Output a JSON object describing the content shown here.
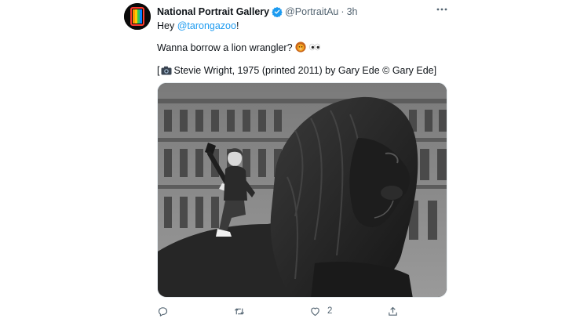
{
  "author": {
    "name": "National Portrait Gallery",
    "handle": "@PortraitAu",
    "separator": "·",
    "time": "3h",
    "verified": true,
    "avatar_icon": "npg-logo-icon"
  },
  "tweet": {
    "greeting": "Hey",
    "mention": "@tarongazoo",
    "exclaim": "!",
    "question": "Wanna borrow a lion wrangler?",
    "emojis": [
      "lion-face-icon",
      "eyes-icon"
    ],
    "credit_open": "[",
    "credit_text": "Stevie Wright, 1975 (printed 2011) by Gary Ede © Gary Ede]",
    "credit_icon": "camera-icon"
  },
  "media": {
    "type": "photo",
    "content": "black-and-white photo of a man sitting on a bronze lion statue"
  },
  "actions": {
    "reply_icon": "reply-icon",
    "retweet_icon": "retweet-icon",
    "like_icon": "heart-icon",
    "like_count": "2",
    "share_icon": "share-icon"
  },
  "colors": {
    "accent": "#1d9bf0",
    "secondary_text": "#536471",
    "primary_text": "#0f1419"
  }
}
